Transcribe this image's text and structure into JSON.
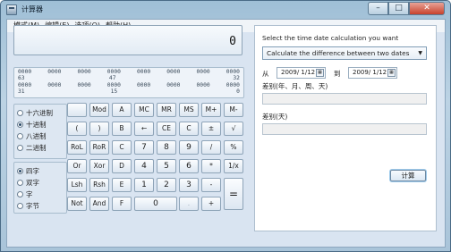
{
  "window": {
    "title": "计算器",
    "min_glyph": "–",
    "max_glyph": "□",
    "close_glyph": "✕"
  },
  "menu": [
    "模式(M)",
    "编辑(E)",
    "选项(O)",
    "帮助(H)"
  ],
  "display": {
    "value": "0"
  },
  "bits": {
    "row1": [
      "0000",
      "0000",
      "0000",
      "0000",
      "0000",
      "0000",
      "0000",
      "0000"
    ],
    "row1_labels": [
      "63",
      "",
      "",
      "47",
      "",
      "",
      "",
      "32"
    ],
    "row2": [
      "0000",
      "0000",
      "0000",
      "0000",
      "0000",
      "0000",
      "0000",
      "0000"
    ],
    "row2_labels": [
      "31",
      "",
      "",
      "15",
      "",
      "",
      "",
      "0"
    ]
  },
  "radix": {
    "options": [
      "十六进制",
      "十进制",
      "八进制",
      "二进制"
    ],
    "selected": "十进制"
  },
  "word_size": {
    "options": [
      "四字",
      "双字",
      "字",
      "字节"
    ],
    "selected": "四字"
  },
  "keys": {
    "row1": [
      "",
      "Mod",
      "A",
      "MC",
      "MR",
      "MS",
      "M+",
      "M-"
    ],
    "row2": [
      "(",
      ")",
      "B",
      "←",
      "CE",
      "C",
      "±",
      "√"
    ],
    "row3": [
      "RoL",
      "RoR",
      "C",
      "7",
      "8",
      "9",
      "/",
      "%"
    ],
    "row4": [
      "Or",
      "Xor",
      "D",
      "4",
      "5",
      "6",
      "*",
      "1/x"
    ],
    "row5": [
      "Lsh",
      "Rsh",
      "E",
      "1",
      "2",
      "3",
      "-",
      "="
    ],
    "row6": [
      "Not",
      "And",
      "F",
      "0",
      ".",
      "+"
    ]
  },
  "date_panel": {
    "prompt": "Select the time date calculation you want",
    "mode": "Calculate the difference between two dates",
    "from_label": "从",
    "from_date": "2009/ 1/12",
    "to_label": "到",
    "to_date": "2009/ 1/12",
    "diff_label_1": "差别(年、月、周、天)",
    "diff_label_2": "差别(天)",
    "calc_button": "计算"
  }
}
